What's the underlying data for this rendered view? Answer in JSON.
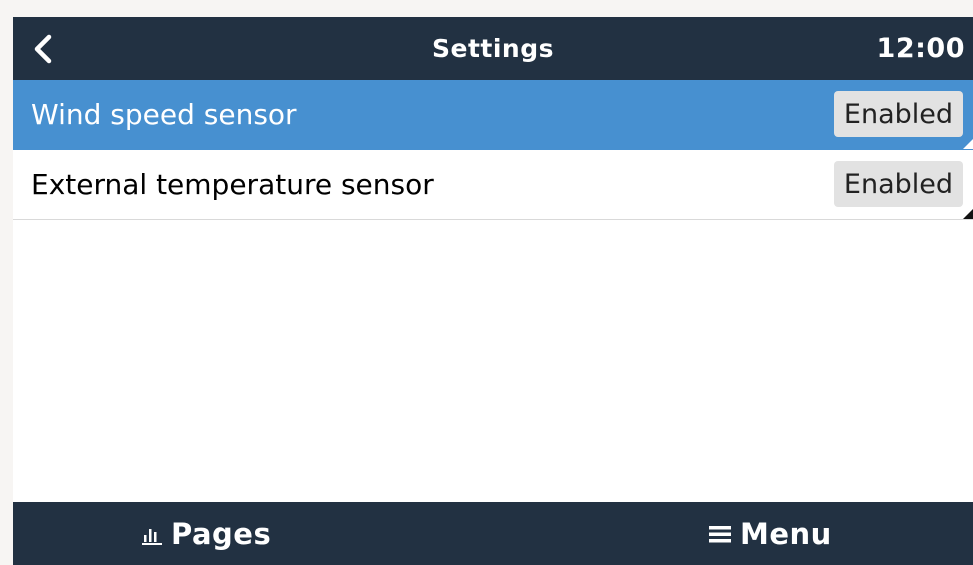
{
  "header": {
    "title": "Settings",
    "clock": "12:00",
    "back_icon": "chevron-left-icon"
  },
  "list": {
    "items": [
      {
        "label": "Wind speed sensor",
        "value": "Enabled",
        "selected": true
      },
      {
        "label": "External temperature sensor",
        "value": "Enabled",
        "selected": false
      }
    ]
  },
  "footer": {
    "pages_label": "Pages",
    "pages_icon": "bar-chart-icon",
    "menu_label": "Menu",
    "menu_icon": "hamburger-menu-icon"
  },
  "colors": {
    "header_bg": "#223142",
    "selected_bg": "#4790d0",
    "value_bg": "#e2e2e2"
  }
}
